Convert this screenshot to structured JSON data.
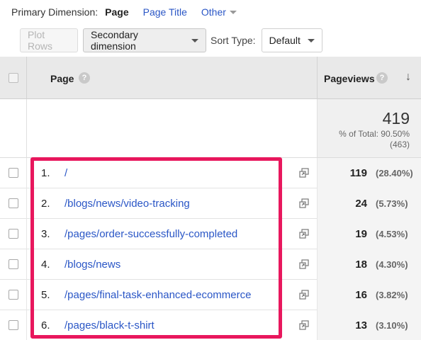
{
  "dimension_bar": {
    "label": "Primary Dimension:",
    "active": "Page",
    "link": "Page Title",
    "other": "Other"
  },
  "toolbar": {
    "plot_rows": "Plot Rows",
    "secondary_dimension": "Secondary dimension",
    "sort_type_label": "Sort Type:",
    "sort_type_value": "Default"
  },
  "table": {
    "col_page": "Page",
    "col_pageviews": "Pageviews",
    "help_glyph": "?",
    "sort_glyph": "↓",
    "totals": {
      "value": "419",
      "percent_line": "% of Total: 90.50%",
      "total_line": "(463)"
    },
    "rows": [
      {
        "num": "1.",
        "page": "/",
        "pageviews": "119",
        "percent": "(28.40%)"
      },
      {
        "num": "2.",
        "page": "/blogs/news/video-tracking",
        "pageviews": "24",
        "percent": "(5.73%)"
      },
      {
        "num": "3.",
        "page": "/pages/order-successfully-completed",
        "pageviews": "19",
        "percent": "(4.53%)"
      },
      {
        "num": "4.",
        "page": "/blogs/news",
        "pageviews": "18",
        "percent": "(4.30%)"
      },
      {
        "num": "5.",
        "page": "/pages/final-task-enhanced-ecommerce",
        "pageviews": "16",
        "percent": "(3.82%)"
      },
      {
        "num": "6.",
        "page": "/pages/black-t-shirt",
        "pageviews": "13",
        "percent": "(3.10%)"
      }
    ]
  },
  "colors": {
    "link": "#2a56c6",
    "highlight": "#e8175d",
    "header_bg": "#e9e9e9"
  },
  "icons": [
    "caret-down-icon",
    "help-icon",
    "sort-desc-icon",
    "open-link-icon",
    "checkbox"
  ]
}
